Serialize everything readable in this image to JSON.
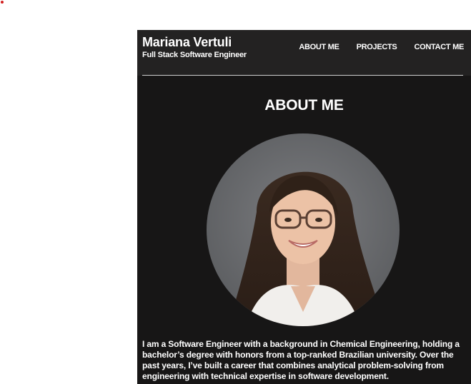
{
  "header": {
    "name": "Mariana Vertuli",
    "subtitle": "Full Stack Software Engineer"
  },
  "nav": {
    "items": [
      {
        "label": "ABOUT ME"
      },
      {
        "label": "PROJECTS"
      },
      {
        "label": "CONTACT ME"
      }
    ]
  },
  "about": {
    "title": "ABOUT ME",
    "bio": "I am a Software Engineer with a background in Chemical Engineering, holding a bachelor’s degree with honors from a top-ranked Brazilian university. Over the past years, I’ve built a career that combines analytical problem-solving from engineering with technical expertise in software development."
  },
  "colors": {
    "page_background": "#171616",
    "header_background": "#232222",
    "text": "#ffffff"
  }
}
